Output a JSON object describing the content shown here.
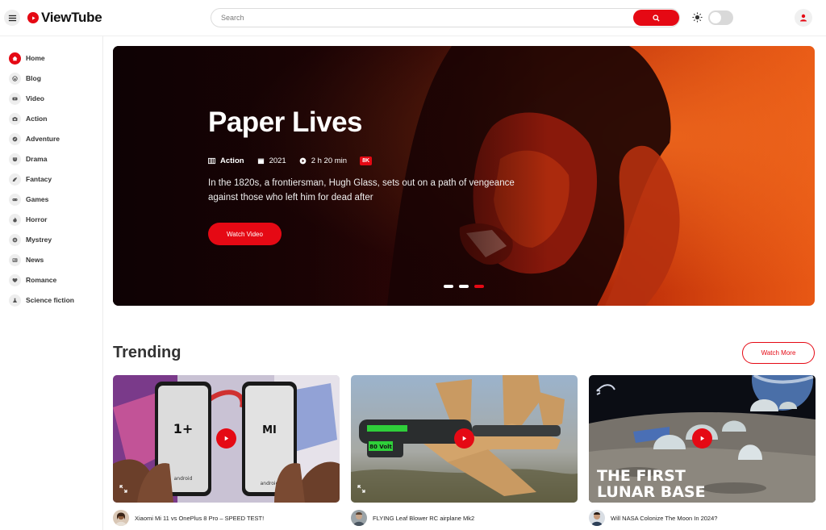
{
  "app": {
    "name": "ViewTube"
  },
  "search": {
    "placeholder": "Search"
  },
  "colors": {
    "accent": "#e50914",
    "sidebar_icon_bg": "#eeeeee"
  },
  "header": {
    "menu_icon": "hamburger-icon",
    "theme_icon": "sun-icon",
    "dark_mode": false,
    "user_icon": "user-icon"
  },
  "sidebar": {
    "items": [
      {
        "label": "Home",
        "icon": "home-icon",
        "active": true
      },
      {
        "label": "Blog",
        "icon": "wordpress-icon",
        "active": false
      },
      {
        "label": "Video",
        "icon": "youtube-icon",
        "active": false
      },
      {
        "label": "Action",
        "icon": "camera-icon",
        "active": false
      },
      {
        "label": "Adventure",
        "icon": "compass-icon",
        "active": false
      },
      {
        "label": "Drama",
        "icon": "mask-icon",
        "active": false
      },
      {
        "label": "Fantacy",
        "icon": "dragon-icon",
        "active": false
      },
      {
        "label": "Games",
        "icon": "gamepad-icon",
        "active": false
      },
      {
        "label": "Horror",
        "icon": "flame-icon",
        "active": false
      },
      {
        "label": "Mystrey",
        "icon": "eye-icon",
        "active": false
      },
      {
        "label": "News",
        "icon": "newspaper-icon",
        "active": false
      },
      {
        "label": "Romance",
        "icon": "heart-icon",
        "active": false
      },
      {
        "label": "Science fiction",
        "icon": "flask-icon",
        "active": false
      }
    ]
  },
  "hero": {
    "title": "Paper Lives",
    "genre": "Action",
    "year": "2021",
    "duration": "2 h 20 min",
    "quality": "8K",
    "description": "In the 1820s, a frontiersman, Hugh Glass, sets out on a path of vengeance against those who left him for dead after",
    "button": "Watch Video",
    "slides": 3,
    "active_slide": 3
  },
  "trending": {
    "title": "Trending",
    "more": "Watch More",
    "videos": [
      {
        "title": "Xiaomi Mi 11 vs OnePlus 8 Pro – SPEED TEST!"
      },
      {
        "title": "FLYING Leaf Blower RC airplane Mk2"
      },
      {
        "title": "Will NASA Colonize The Moon In 2024?",
        "thumb_text_1": "THE FIRST",
        "thumb_text_2": "LUNAR BASE"
      }
    ],
    "phone_labels": {
      "left": "1+",
      "right": "MI",
      "android_1": "android",
      "android_2": "android"
    },
    "blower_label": "80 Volt"
  }
}
